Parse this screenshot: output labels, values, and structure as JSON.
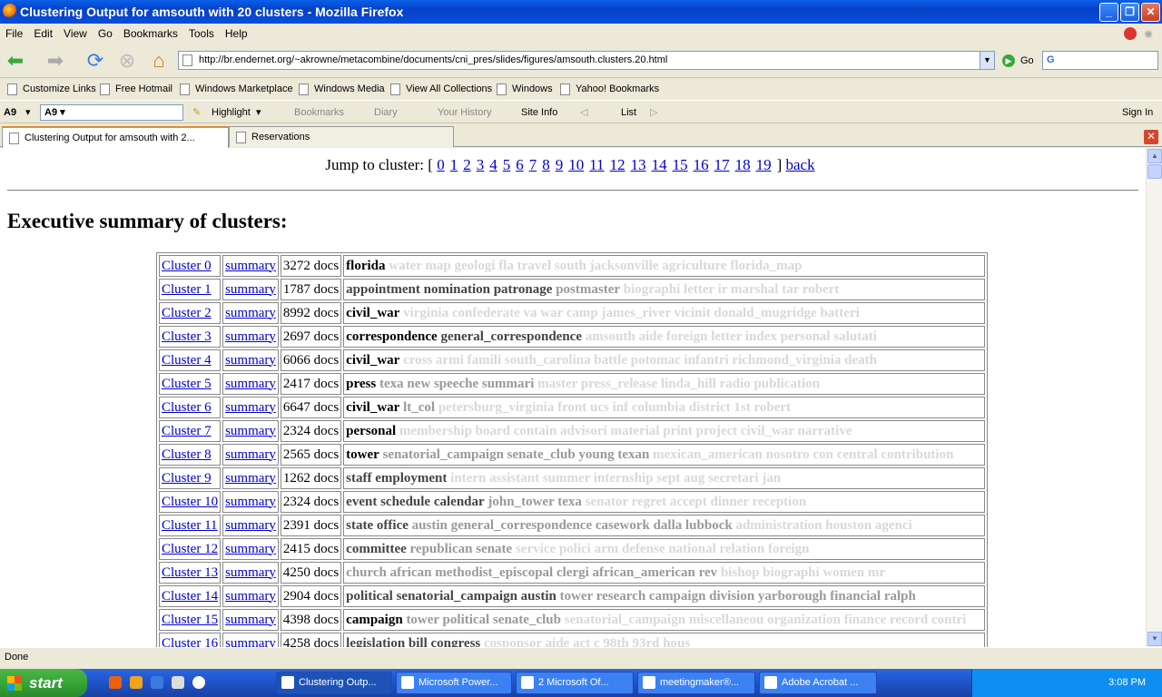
{
  "window": {
    "title": "Clustering Output for amsouth with 20 clusters - Mozilla Firefox"
  },
  "menu": [
    "File",
    "Edit",
    "View",
    "Go",
    "Bookmarks",
    "Tools",
    "Help"
  ],
  "nav": {
    "url": "http://br.endernet.org/~akrowne/metacombine/documents/cni_pres/slides/figures/amsouth.clusters.20.html",
    "go_label": "Go",
    "search_placeholder": "G"
  },
  "bookmarks": [
    "Customize Links",
    "Free Hotmail",
    "Windows Marketplace",
    "Windows Media",
    "View All Collections",
    "Windows",
    "Yahoo! Bookmarks"
  ],
  "toolbar": {
    "search_prefix": "A9",
    "highlight": "Highlight",
    "bookmarks": "Bookmarks",
    "diary": "Diary",
    "history": "Your History",
    "siteinfo": "Site Info",
    "list": "List",
    "signin": "Sign In"
  },
  "tabs": [
    {
      "label": "Clustering Output for amsouth with 2..."
    },
    {
      "label": "Reservations"
    }
  ],
  "page": {
    "jump_label": "Jump to cluster: [",
    "jump_links": [
      "0",
      "1",
      "2",
      "3",
      "4",
      "5",
      "6",
      "7",
      "8",
      "9",
      "10",
      "11",
      "12",
      "13",
      "14",
      "15",
      "16",
      "17",
      "18",
      "19"
    ],
    "jump_close": "]",
    "back_label": "back",
    "heading": "Executive summary of clusters:",
    "summary_label": "summary",
    "clusters": [
      {
        "name": "Cluster 0",
        "docs": "3272 docs",
        "terms": [
          [
            "florida",
            1
          ],
          [
            "water map geologi fla travel south jacksonville agriculture florida_map",
            4
          ]
        ]
      },
      {
        "name": "Cluster 1",
        "docs": "1787 docs",
        "terms": [
          [
            "appointment nomination patronage",
            2
          ],
          [
            "postmaster",
            3
          ],
          [
            "biographi letter ir marshal tar robert",
            4
          ]
        ]
      },
      {
        "name": "Cluster 2",
        "docs": "8992 docs",
        "terms": [
          [
            "civil_war",
            1
          ],
          [
            "virginia confederate va war camp james_river vicinit donald_mugridge batteri",
            4
          ]
        ]
      },
      {
        "name": "Cluster 3",
        "docs": "2697 docs",
        "terms": [
          [
            "correspondence",
            1
          ],
          [
            "general_correspondence",
            2
          ],
          [
            "amsouth aide foreign letter index personal salutati",
            4
          ]
        ]
      },
      {
        "name": "Cluster 4",
        "docs": "6066 docs",
        "terms": [
          [
            "civil_war",
            1
          ],
          [
            "cross armi famili south_carolina battle potomac infantri richmond_virginia death",
            4
          ]
        ]
      },
      {
        "name": "Cluster 5",
        "docs": "2417 docs",
        "terms": [
          [
            "press",
            1
          ],
          [
            "texa new speeche summari",
            3
          ],
          [
            "master press_release linda_hill radio publication",
            4
          ]
        ]
      },
      {
        "name": "Cluster 6",
        "docs": "6647 docs",
        "terms": [
          [
            "civil_war",
            1
          ],
          [
            "lt_col",
            3
          ],
          [
            "petersburg_virginia front ucs inf columbia district 1st robert",
            4
          ]
        ]
      },
      {
        "name": "Cluster 7",
        "docs": "2324 docs",
        "terms": [
          [
            "personal",
            1
          ],
          [
            "membership board contain advisori material print project civil_war narrative",
            4
          ]
        ]
      },
      {
        "name": "Cluster 8",
        "docs": "2565 docs",
        "terms": [
          [
            "tower",
            1
          ],
          [
            "senatorial_campaign senate_club young texan",
            3
          ],
          [
            "mexican_american nosotro con central contribution",
            4
          ]
        ]
      },
      {
        "name": "Cluster 9",
        "docs": "1262 docs",
        "terms": [
          [
            "staff employment",
            2
          ],
          [
            "intern assistant summer internship sept aug secretari jan",
            4
          ]
        ]
      },
      {
        "name": "Cluster 10",
        "docs": "2324 docs",
        "terms": [
          [
            "event schedule calendar",
            2
          ],
          [
            "john_tower texa",
            3
          ],
          [
            "senator regret accept dinner reception",
            4
          ]
        ]
      },
      {
        "name": "Cluster 11",
        "docs": "2391 docs",
        "terms": [
          [
            "state office",
            2
          ],
          [
            "austin general_correspondence casework dalla lubbock",
            3
          ],
          [
            "administration houston agenci",
            4
          ]
        ]
      },
      {
        "name": "Cluster 12",
        "docs": "2415 docs",
        "terms": [
          [
            "committee",
            2
          ],
          [
            "republican senate",
            3
          ],
          [
            "service polici arm defense national relation foreign",
            4
          ]
        ]
      },
      {
        "name": "Cluster 13",
        "docs": "4250 docs",
        "terms": [
          [
            "church african methodist_episcopal clergi african_american rev",
            3
          ],
          [
            "bishop biographi women mr",
            4
          ]
        ]
      },
      {
        "name": "Cluster 14",
        "docs": "2904 docs",
        "terms": [
          [
            "political senatorial_campaign austin",
            2
          ],
          [
            "tower research campaign division yarborough financial ralph",
            3
          ]
        ]
      },
      {
        "name": "Cluster 15",
        "docs": "4398 docs",
        "terms": [
          [
            "campaign",
            1
          ],
          [
            "tower political senate_club",
            3
          ],
          [
            "senatorial_campaign miscellaneou organization finance record contri",
            4
          ]
        ]
      },
      {
        "name": "Cluster 16",
        "docs": "4258 docs",
        "terms": [
          [
            "legislation bill congress",
            2
          ],
          [
            "cosponsor aide act c 98th 93rd hous",
            4
          ]
        ]
      }
    ]
  },
  "status": "Done",
  "taskbar": {
    "start": "start",
    "items": [
      "Clustering Outp...",
      "Microsoft Power...",
      "2 Microsoft Of...",
      "meetingmaker®...",
      "Adobe Acrobat ..."
    ],
    "clock": "3:08 PM"
  }
}
